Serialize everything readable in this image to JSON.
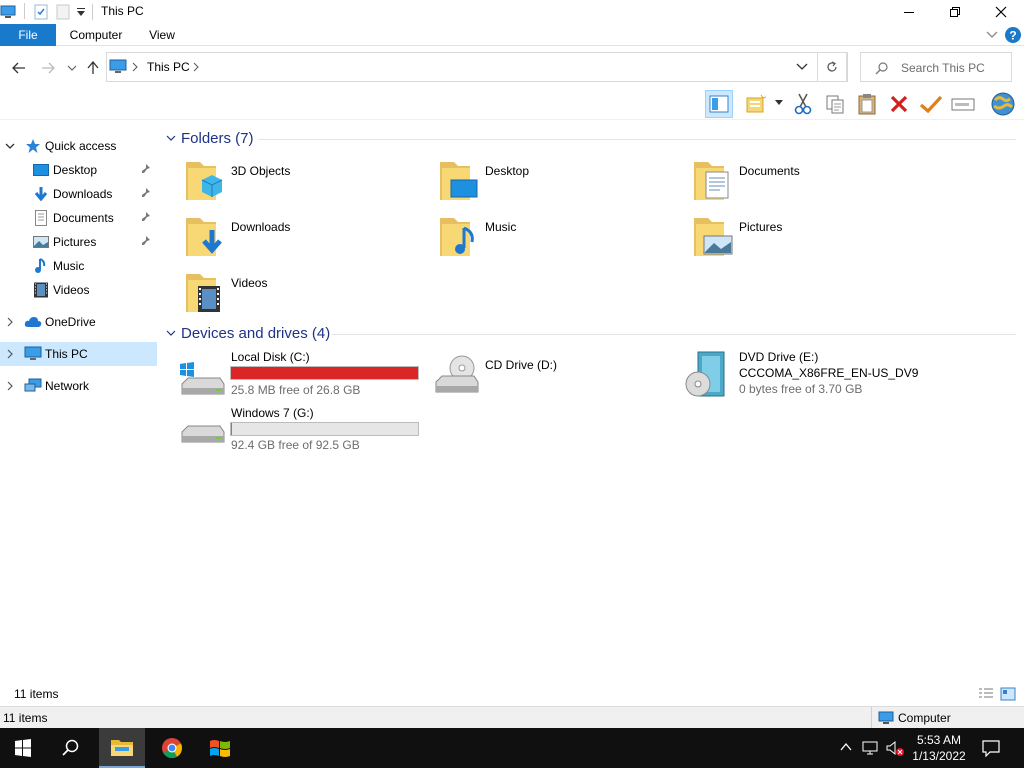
{
  "window": {
    "title": "This PC"
  },
  "ribbon": {
    "tabs": [
      "File",
      "Computer",
      "View"
    ]
  },
  "address": {
    "crumb": "This PC",
    "search_placeholder": "Search This PC"
  },
  "nav": {
    "quick_access": "Quick access",
    "quick_items": [
      "Desktop",
      "Downloads",
      "Documents",
      "Pictures",
      "Music",
      "Videos"
    ],
    "onedrive": "OneDrive",
    "this_pc": "This PC",
    "network": "Network"
  },
  "folders": {
    "header": "Folders (7)",
    "items": [
      "3D Objects",
      "Desktop",
      "Documents",
      "Downloads",
      "Music",
      "Pictures",
      "Videos"
    ]
  },
  "drives": {
    "header": "Devices and drives (4)",
    "items": [
      {
        "name": "Local Disk (C:)",
        "free": "25.8 MB free of 26.8 GB",
        "used_fraction": 0.999,
        "bar_color": "#da2626"
      },
      {
        "name": "CD Drive (D:)"
      },
      {
        "name": "DVD Drive (E:)",
        "label": "CCCOMA_X86FRE_EN-US_DV9",
        "free": "0 bytes free of 3.70 GB"
      },
      {
        "name": "Windows 7 (G:)",
        "free": "92.4 GB free of 92.5 GB",
        "used_fraction": 0.001,
        "bar_color": "#26a0da"
      }
    ]
  },
  "status": {
    "count": "11 items",
    "count2": "11 items",
    "zone": "Computer"
  },
  "taskbar": {
    "time": "5:53 AM",
    "date": "1/13/2022"
  },
  "colors": {
    "accent": "#1979ca",
    "header_text": "#1e3287",
    "selection": "#cce8ff"
  }
}
